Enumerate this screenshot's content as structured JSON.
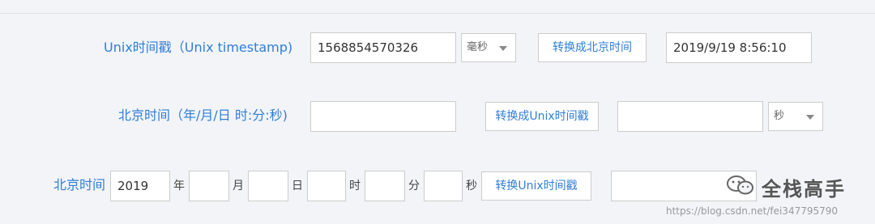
{
  "row1": {
    "label": "Unix时间戳（Unix timestamp)",
    "timestamp_value": "1568854570326",
    "unit_select": "毫秒",
    "convert_button": "转换成北京时间",
    "result_value": "2019/9/19 8:56:10"
  },
  "row2": {
    "label": "北京时间（年/月/日 时:分:秒)",
    "datetime_value": "",
    "convert_button": "转换成Unix时间戳",
    "result_value": "",
    "unit_select": "秒"
  },
  "row3": {
    "label": "北京时间",
    "year_value": "2019",
    "year_unit": "年",
    "month_value": "",
    "month_unit": "月",
    "day_value": "",
    "day_unit": "日",
    "hour_value": "",
    "hour_unit": "时",
    "minute_value": "",
    "minute_unit": "分",
    "second_value": "",
    "second_unit": "秒",
    "convert_button": "转换Unix时间戳",
    "result_value": ""
  },
  "watermark": {
    "brand": "全栈高手",
    "url": "https://blog.csdn.net/fei347795790",
    "icon": "wechat-icon"
  },
  "colors": {
    "accent": "#2f7ed8",
    "background": "#f3f4f8"
  }
}
